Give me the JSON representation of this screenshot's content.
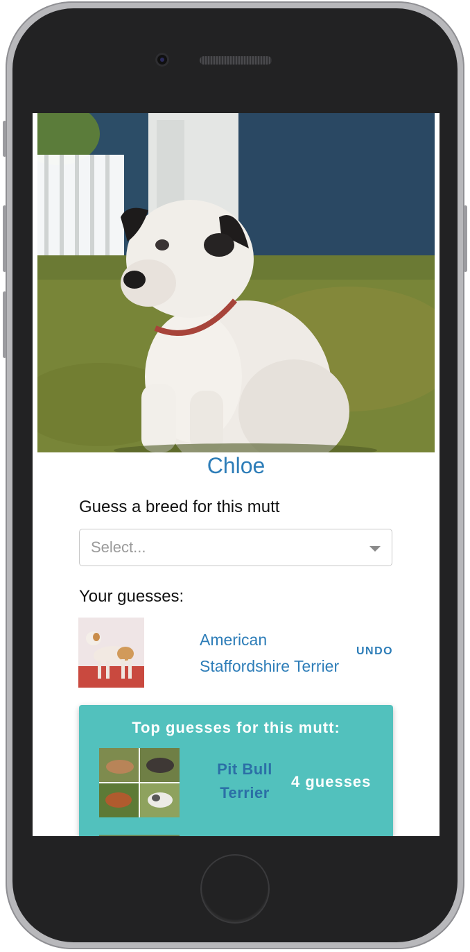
{
  "dog": {
    "name": "Chloe",
    "photo_icon": "dog-photo"
  },
  "guess_form": {
    "prompt": "Guess a breed for this mutt",
    "select_placeholder": "Select..."
  },
  "your_guesses": {
    "heading": "Your guesses:",
    "items": [
      {
        "breed": "American Staffordshire Terrier",
        "undo_label": "UNDO"
      }
    ]
  },
  "top_guesses": {
    "title": "Top guesses for this mutt:",
    "items": [
      {
        "breed": "Pit Bull Terrier",
        "count": "4 guesses"
      }
    ]
  },
  "colors": {
    "accent": "#2d7db8",
    "card": "#52c1bd"
  }
}
